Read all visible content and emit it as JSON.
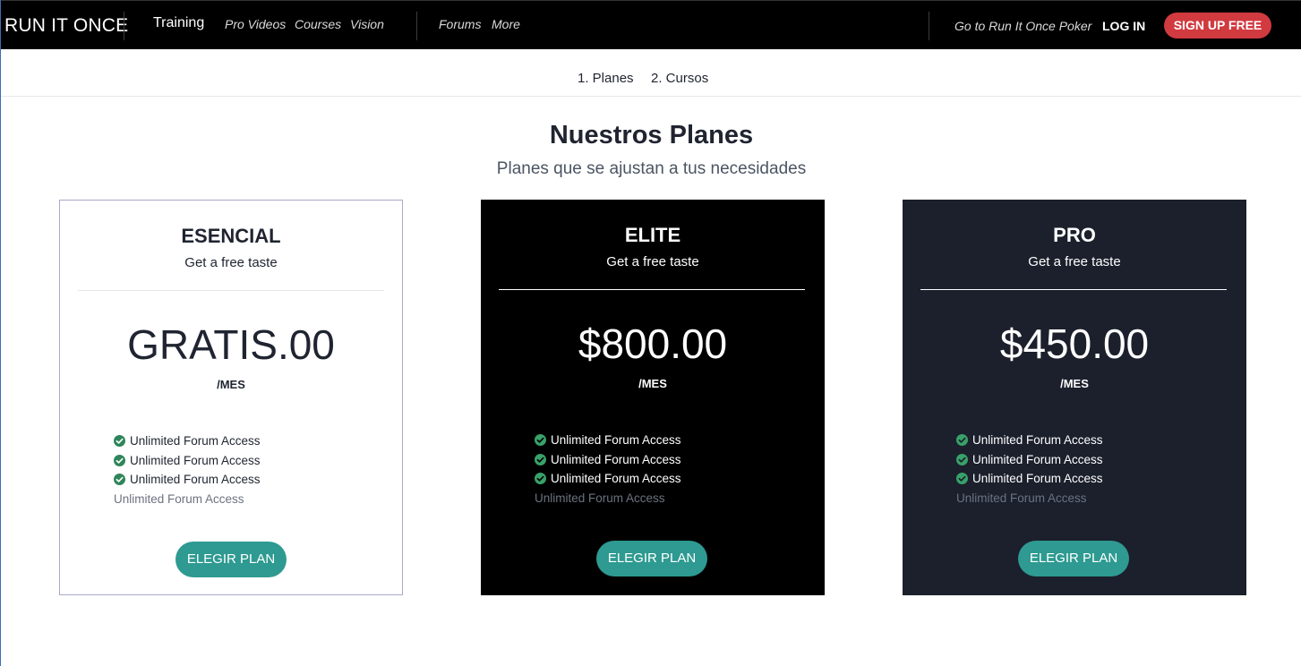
{
  "navbar": {
    "brand": "RUN IT ONCE",
    "training": "Training",
    "pro_videos": "Pro Videos",
    "courses": "Courses",
    "vision": "Vision",
    "forums": "Forums",
    "more": "More",
    "go_poker": "Go to Run It Once Poker",
    "login": "LOG IN",
    "signup": "SIGN UP FREE"
  },
  "steps": {
    "plans": "1. Planes",
    "courses": "2. Cursos"
  },
  "header": {
    "title": "Nuestros Planes",
    "subtitle": "Planes que se ajustan a tus necesidades"
  },
  "plans": [
    {
      "name": "ESENCIAL",
      "tagline": "Get a free taste",
      "price": "GRATIS.00",
      "period": "/MES",
      "features": [
        "Unlimited Forum Access",
        "Unlimited Forum Access",
        "Unlimited Forum Access"
      ],
      "disabled_feature": "Unlimited Forum Access",
      "button": "ELEGIR PLAN"
    },
    {
      "name": "ELITE",
      "tagline": "Get a free taste",
      "price": "$800.00",
      "period": "/MES",
      "features": [
        "Unlimited Forum Access",
        "Unlimited Forum Access",
        "Unlimited Forum Access"
      ],
      "disabled_feature": "Unlimited Forum Access",
      "button": "ELEGIR PLAN"
    },
    {
      "name": "PRO",
      "tagline": "Get a free taste",
      "price": "$450.00",
      "period": "/MES",
      "features": [
        "Unlimited Forum Access",
        "Unlimited Forum Access",
        "Unlimited Forum Access"
      ],
      "disabled_feature": "Unlimited Forum Access",
      "button": "ELEGIR PLAN"
    }
  ],
  "colors": {
    "navbar_bg": "#000000",
    "signup_bg": "#d13a3f",
    "button_teal": "#2e9a91",
    "check_green": "#2f855a",
    "card_navy": "#1b202c"
  },
  "icons": {
    "check": "check-circle-icon"
  }
}
